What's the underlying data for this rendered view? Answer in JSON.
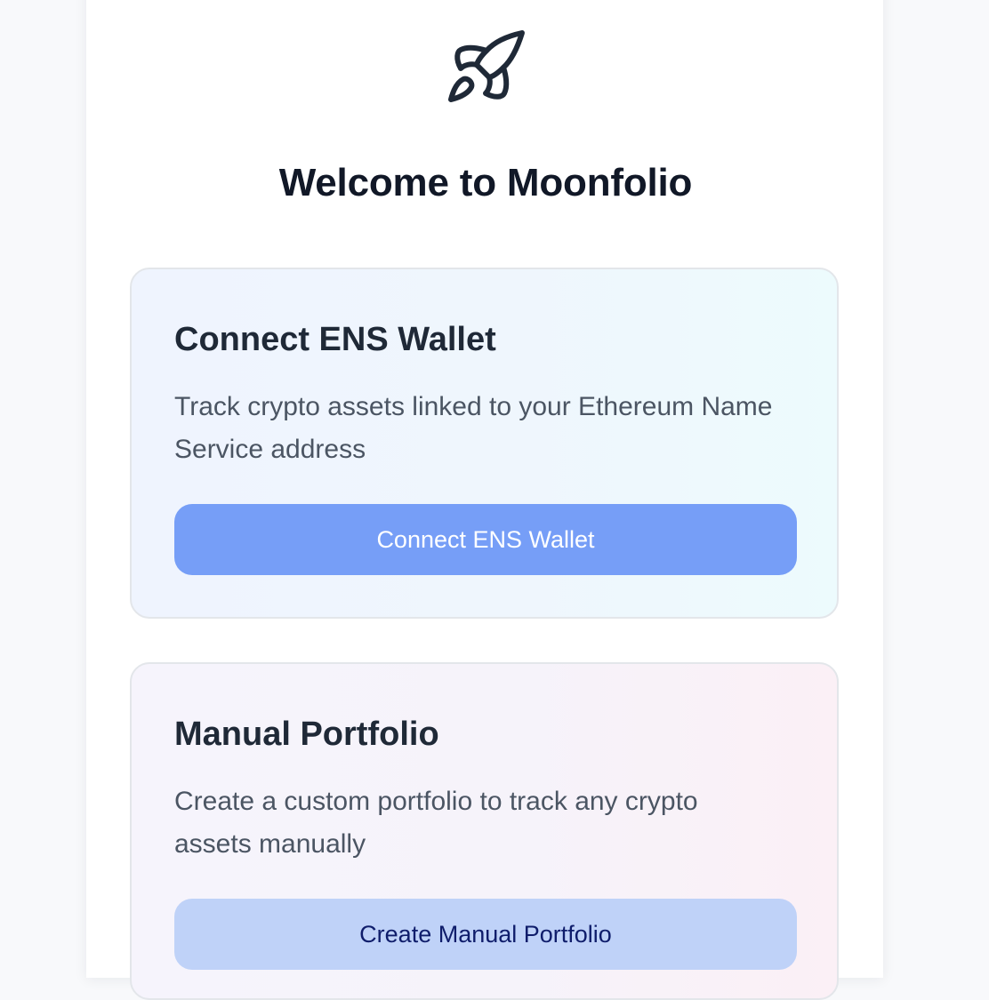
{
  "page": {
    "title": "Welcome to Moonfolio",
    "logo_icon": "rocket-icon"
  },
  "cards": {
    "ens": {
      "title": "Connect ENS Wallet",
      "description": "Track crypto assets linked to your Ethereum Name Service address",
      "button_label": "Connect ENS Wallet"
    },
    "manual": {
      "title": "Manual Portfolio",
      "description": "Create a custom portfolio to track any crypto assets manually",
      "button_label": "Create Manual Portfolio"
    }
  },
  "colors": {
    "page_background": "#f8f9fb",
    "panel_background": "#ffffff",
    "title_text": "#111827",
    "primary_button": "#769ef7",
    "secondary_button": "#bfd2f8",
    "secondary_button_text": "#0f1d6b"
  }
}
